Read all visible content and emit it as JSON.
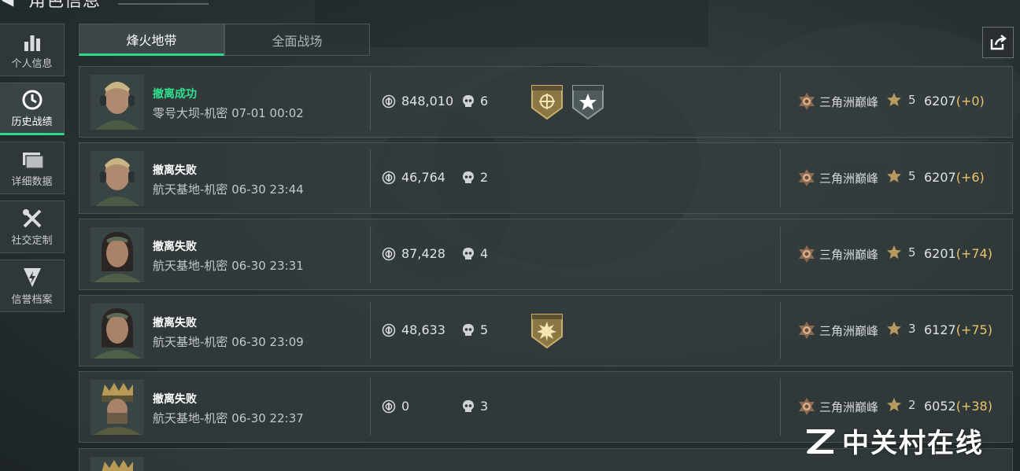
{
  "header": {
    "title": "角色信息",
    "back_icon": "back-arrow-icon"
  },
  "sidebar": {
    "items": [
      {
        "label": "个人信息",
        "icon": "bar-chart-icon",
        "active": false
      },
      {
        "label": "历史战绩",
        "icon": "history-clock-icon",
        "active": true
      },
      {
        "label": "详细数据",
        "icon": "folder-icon",
        "active": false
      },
      {
        "label": "社交定制",
        "icon": "tools-icon",
        "active": false
      },
      {
        "label": "信誉档案",
        "icon": "shield-bolt-icon",
        "active": false
      }
    ]
  },
  "tabs": [
    {
      "label": "烽火地带",
      "active": true
    },
    {
      "label": "全面战场",
      "active": false
    }
  ],
  "share_icon": "share-icon",
  "records": [
    {
      "status": "撤离成功",
      "success": true,
      "map": "零号大坝-机密",
      "time": "07-01 00:02",
      "coins": "848,010",
      "kills": "6",
      "badges": [
        "gold",
        "silver"
      ],
      "rank": "三角洲巅峰",
      "stars": "5",
      "score": "6207",
      "delta": "(+0)"
    },
    {
      "status": "撤离失败",
      "success": false,
      "map": "航天基地-机密",
      "time": "06-30 23:44",
      "coins": "46,764",
      "kills": "2",
      "badges": [],
      "rank": "三角洲巅峰",
      "stars": "5",
      "score": "6207",
      "delta": "(+6)"
    },
    {
      "status": "撤离失败",
      "success": false,
      "map": "航天基地-机密",
      "time": "06-30 23:31",
      "coins": "87,428",
      "kills": "4",
      "badges": [],
      "rank": "三角洲巅峰",
      "stars": "5",
      "score": "6201",
      "delta": "(+74)"
    },
    {
      "status": "撤离失败",
      "success": false,
      "map": "航天基地-机密",
      "time": "06-30 23:09",
      "coins": "48,633",
      "kills": "5",
      "badges": [
        "gold-star"
      ],
      "rank": "三角洲巅峰",
      "stars": "3",
      "score": "6127",
      "delta": "(+75)"
    },
    {
      "status": "撤离失败",
      "success": false,
      "map": "航天基地-机密",
      "time": "06-30 22:37",
      "coins": "0",
      "kills": "3",
      "badges": [],
      "rank": "三角洲巅峰",
      "stars": "2",
      "score": "6052",
      "delta": "(+38)"
    }
  ],
  "watermark": "中关村在线",
  "colors": {
    "accent": "#2fd98a",
    "delta": "#e9c46a",
    "success": "#2fe08e"
  }
}
